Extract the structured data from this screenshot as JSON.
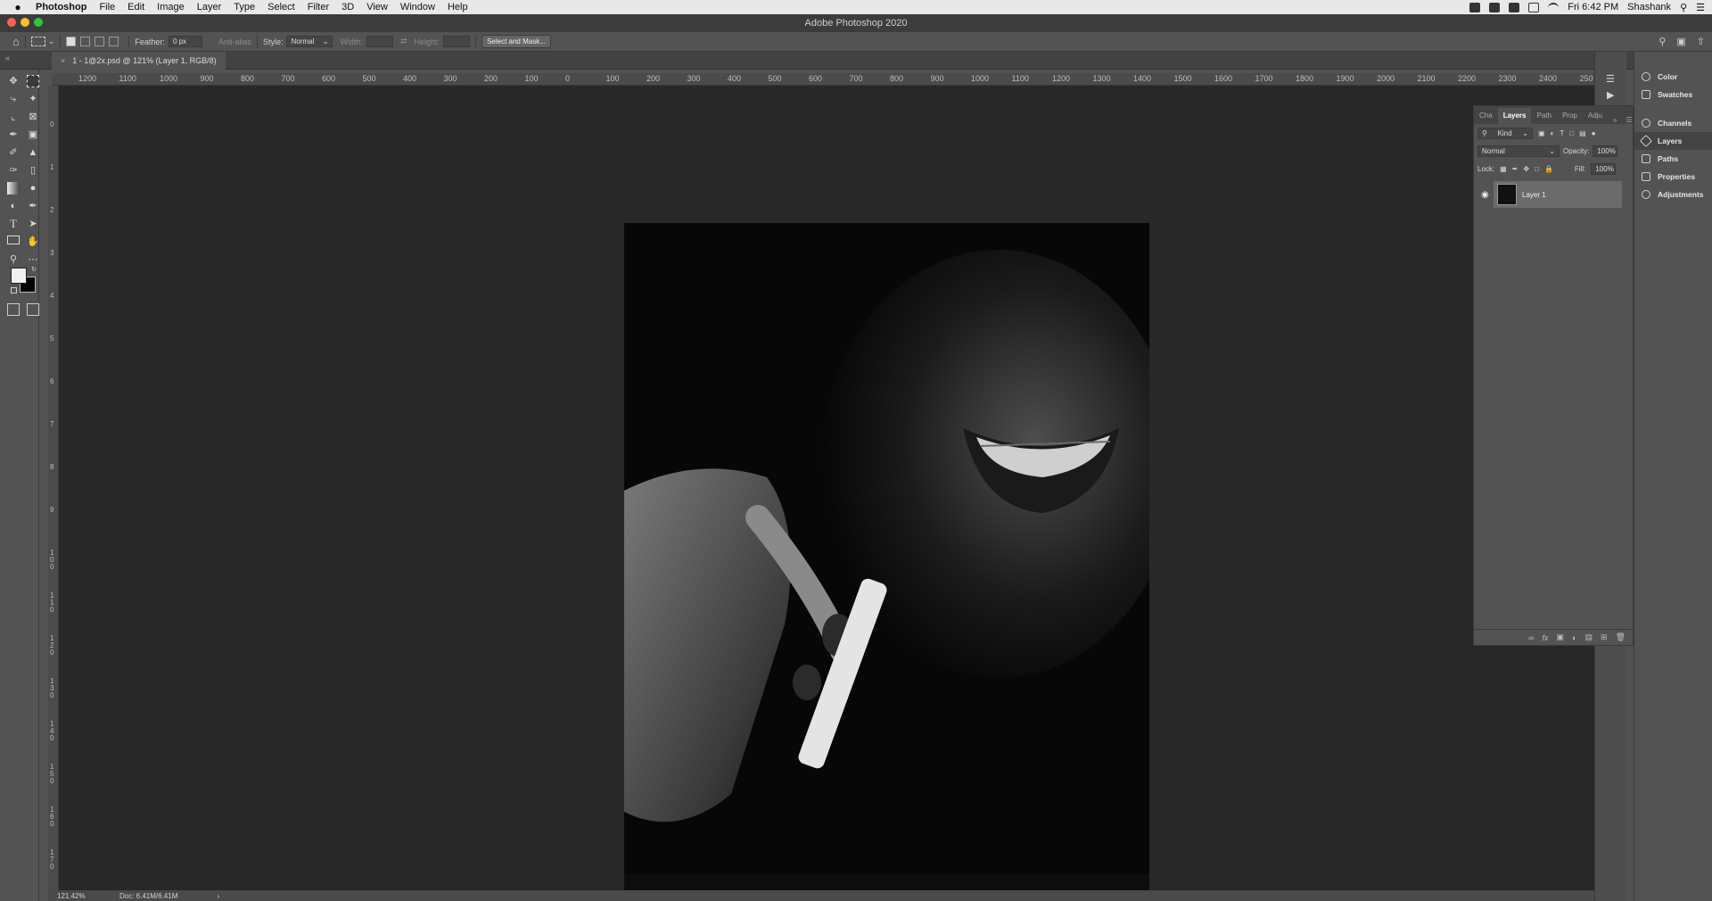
{
  "menubar": {
    "app_name": "Photoshop",
    "menus": [
      "File",
      "Edit",
      "Image",
      "Layer",
      "Type",
      "Select",
      "Filter",
      "3D",
      "View",
      "Window",
      "Help"
    ],
    "clock": "Fri 6:42 PM",
    "user": "Shashank"
  },
  "window": {
    "title": "Adobe Photoshop 2020"
  },
  "options": {
    "feather_label": "Feather:",
    "feather_value": "0 px",
    "anti_alias_label": "Anti-alias",
    "style_label": "Style:",
    "style_value": "Normal",
    "width_label": "Width:",
    "height_label": "Height:",
    "select_and_mask": "Select and Mask..."
  },
  "document": {
    "tab_title": "1 - 1@2x.psd @ 121% (Layer 1, RGB/8)"
  },
  "ruler": {
    "h_labels": [
      "1200",
      "1100",
      "1000",
      "900",
      "800",
      "700",
      "600",
      "500",
      "400",
      "300",
      "200",
      "100",
      "0",
      "100",
      "200",
      "300",
      "400",
      "500",
      "600",
      "700",
      "800",
      "900",
      "1000",
      "1100",
      "1200",
      "1300",
      "1400",
      "1500",
      "1600",
      "1700",
      "1800",
      "1900",
      "2000",
      "2100",
      "2200",
      "2300",
      "2400",
      "250"
    ],
    "v_labels": [
      "0",
      "1",
      "2",
      "3",
      "4",
      "5",
      "6",
      "7",
      "8",
      "9",
      "1 0 0",
      "1 1 0",
      "1 2 0",
      "1 3 0",
      "1 4 0",
      "1 5 0",
      "1 6 0",
      "1 7 0"
    ]
  },
  "status": {
    "zoom": "121.42%",
    "doc": "Doc: 6.41M/6.41M"
  },
  "layers_panel": {
    "tabs": [
      "Cha",
      "Layers",
      "Path",
      "Prop",
      "Adju"
    ],
    "kind_label": "Kind",
    "blend_mode": "Normal",
    "opacity_label": "Opacity:",
    "opacity_value": "100%",
    "lock_label": "Lock:",
    "fill_label": "Fill:",
    "fill_value": "100%",
    "layers": [
      {
        "name": "Layer 1"
      }
    ]
  },
  "dock": {
    "items": [
      "Color",
      "Swatches",
      "Channels",
      "Layers",
      "Paths",
      "Properties",
      "Adjustments"
    ]
  }
}
